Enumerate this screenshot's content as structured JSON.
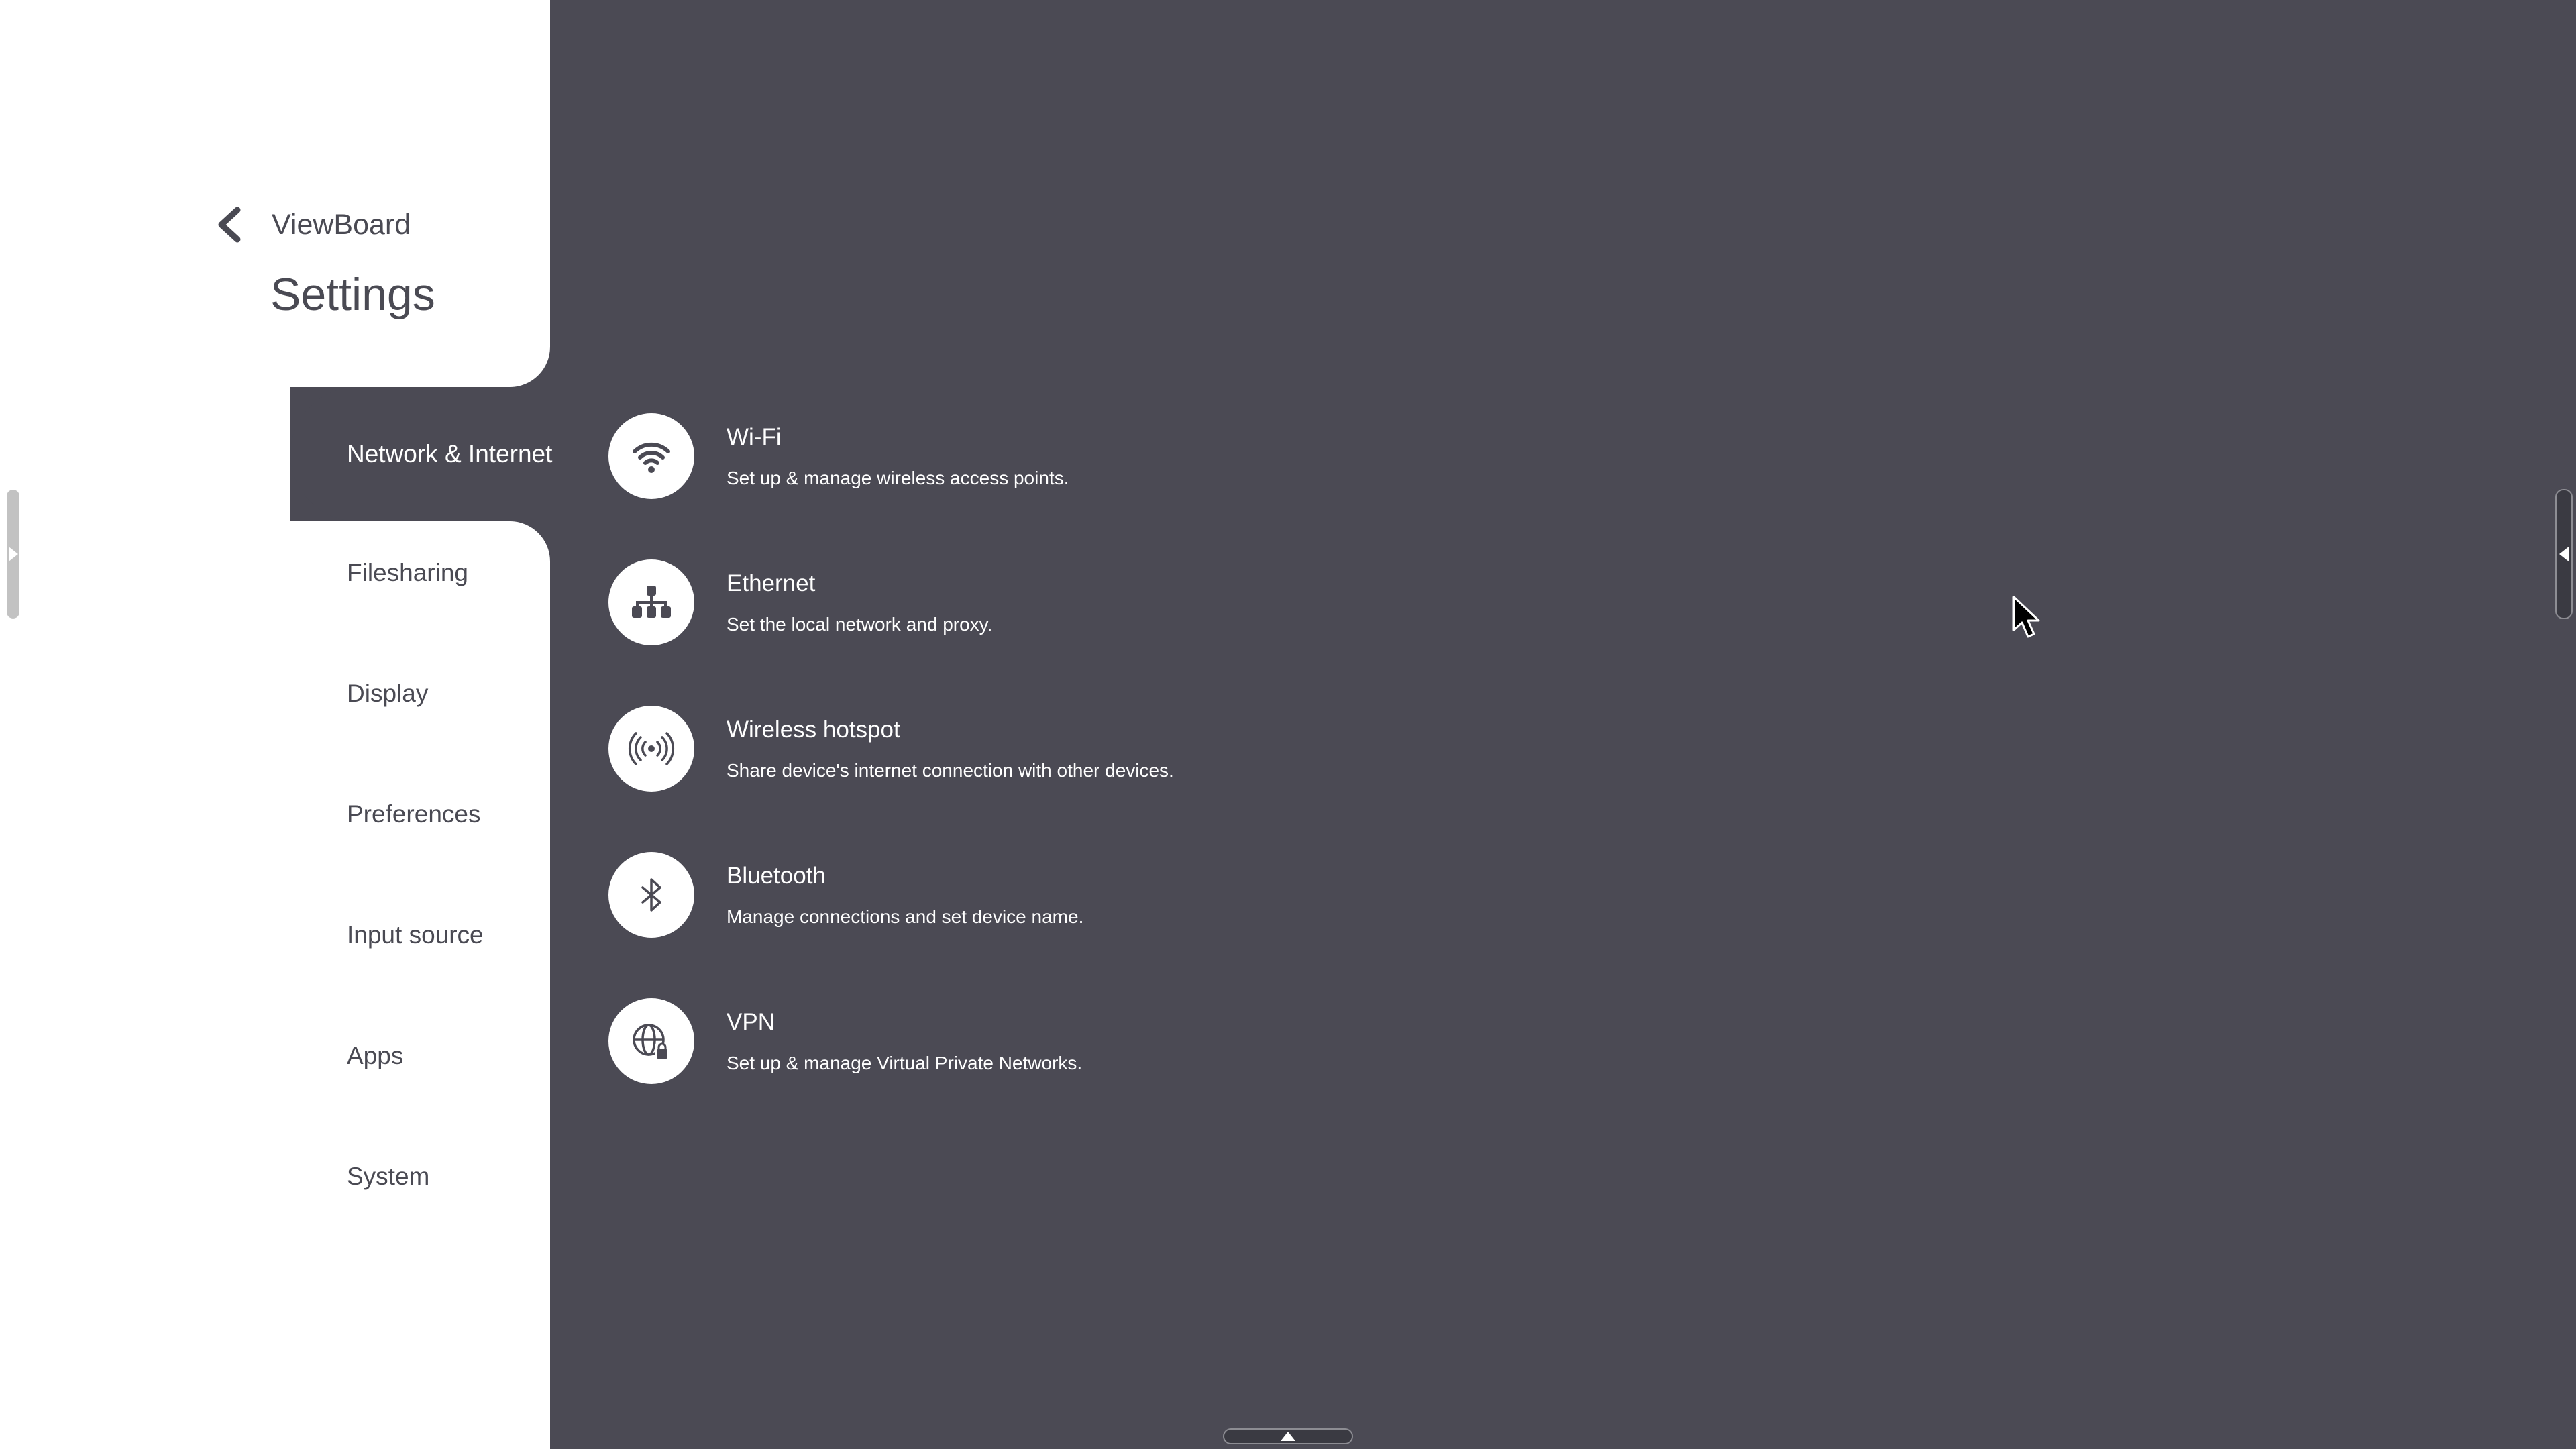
{
  "header": {
    "back_label": "ViewBoard",
    "title": "Settings"
  },
  "sidebar": {
    "selected_index": 0,
    "items": [
      {
        "label": "Network & Internet"
      },
      {
        "label": "Filesharing"
      },
      {
        "label": "Display"
      },
      {
        "label": "Preferences"
      },
      {
        "label": "Input source"
      },
      {
        "label": "Apps"
      },
      {
        "label": "System"
      }
    ]
  },
  "main": {
    "items": [
      {
        "icon": "wifi-icon",
        "title": "Wi-Fi",
        "description": "Set up & manage wireless access points."
      },
      {
        "icon": "ethernet-icon",
        "title": "Ethernet",
        "description": "Set the local network and proxy."
      },
      {
        "icon": "hotspot-icon",
        "title": "Wireless hotspot",
        "description": "Share device's internet connection with other devices."
      },
      {
        "icon": "bluetooth-icon",
        "title": "Bluetooth",
        "description": "Manage connections and set device name."
      },
      {
        "icon": "vpn-icon",
        "title": "VPN",
        "description": "Set up & manage Virtual Private Networks."
      }
    ]
  },
  "colors": {
    "background": "#4b4a54",
    "sidebar": "#ffffff",
    "sidebar_text": "#4a4a53",
    "selected_text": "#ffffff",
    "handle_light": "#c2c2c2",
    "handle_dark": "#3a3a42"
  }
}
